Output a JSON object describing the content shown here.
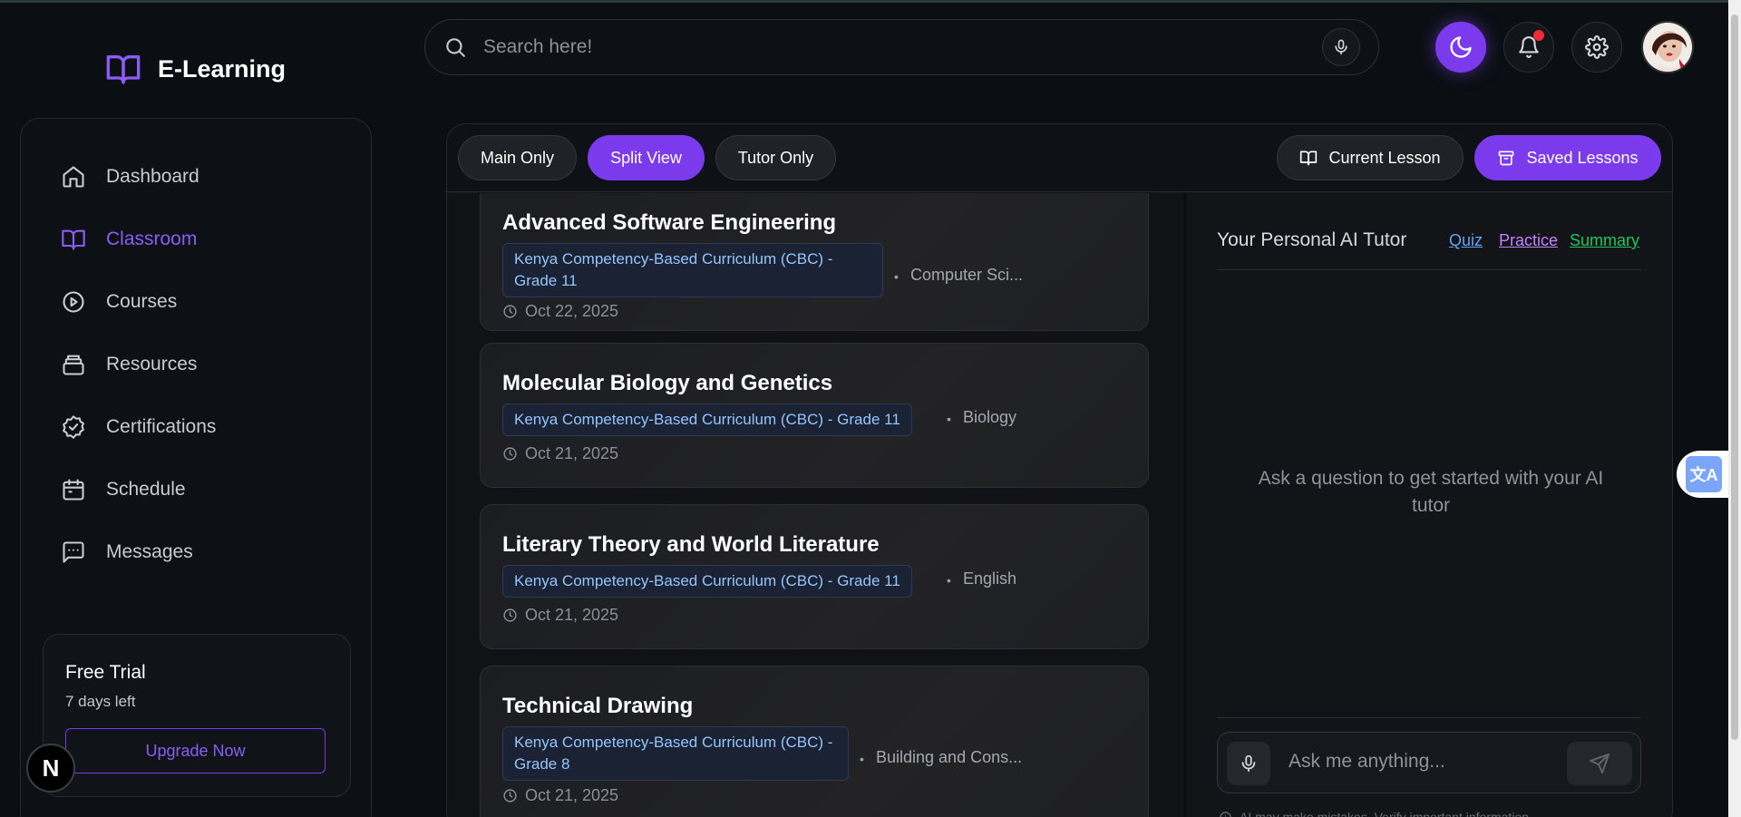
{
  "app": {
    "name": "E-Learning"
  },
  "search": {
    "placeholder": "Search here!"
  },
  "sidebar": {
    "items": [
      {
        "label": "Dashboard",
        "icon": "home-icon"
      },
      {
        "label": "Classroom",
        "icon": "book-open-icon",
        "active": true
      },
      {
        "label": "Courses",
        "icon": "play-circle-icon"
      },
      {
        "label": "Resources",
        "icon": "stack-icon"
      },
      {
        "label": "Certifications",
        "icon": "badge-check-icon"
      },
      {
        "label": "Schedule",
        "icon": "calendar-icon"
      },
      {
        "label": "Messages",
        "icon": "message-square-icon"
      }
    ],
    "trial": {
      "title": "Free Trial",
      "days_left": "7 days left",
      "upgrade_label": "Upgrade Now"
    }
  },
  "nextjs_badge": "N",
  "toolbar": {
    "views": [
      "Main Only",
      "Split View",
      "Tutor Only"
    ],
    "active_view": "Split View",
    "current_lesson_label": "Current Lesson",
    "saved_lessons_label": "Saved Lessons"
  },
  "lessons": [
    {
      "title": "Advanced Software Engineering",
      "curriculum": "Kenya Competency-Based Curriculum (CBC) - Grade 11",
      "subject": "Computer Sci...",
      "date": "Oct 22, 2025"
    },
    {
      "title": "Molecular Biology and Genetics",
      "curriculum": "Kenya Competency-Based Curriculum (CBC) - Grade 11",
      "subject": "Biology",
      "date": "Oct 21, 2025"
    },
    {
      "title": "Literary Theory and World Literature",
      "curriculum": "Kenya Competency-Based Curriculum (CBC) - Grade 11",
      "subject": "English",
      "date": "Oct 21, 2025"
    },
    {
      "title": "Technical Drawing",
      "curriculum": "Kenya Competency-Based Curriculum (CBC) - Grade 8",
      "subject": "Building and Cons...",
      "date": "Oct 21, 2025"
    }
  ],
  "tutor": {
    "title": "Your Personal AI Tutor",
    "links": {
      "quiz": "Quiz",
      "practice": "Practice",
      "summary": "Summary"
    },
    "empty_state": "Ask a question to get started with your AI tutor",
    "input_placeholder": "Ask me anything...",
    "disclaimer": "AI may make mistakes. Verify important information."
  },
  "colors": {
    "accent": "#7c3aed",
    "tag_text": "#93c5fd",
    "notification": "#ef2b3a"
  }
}
